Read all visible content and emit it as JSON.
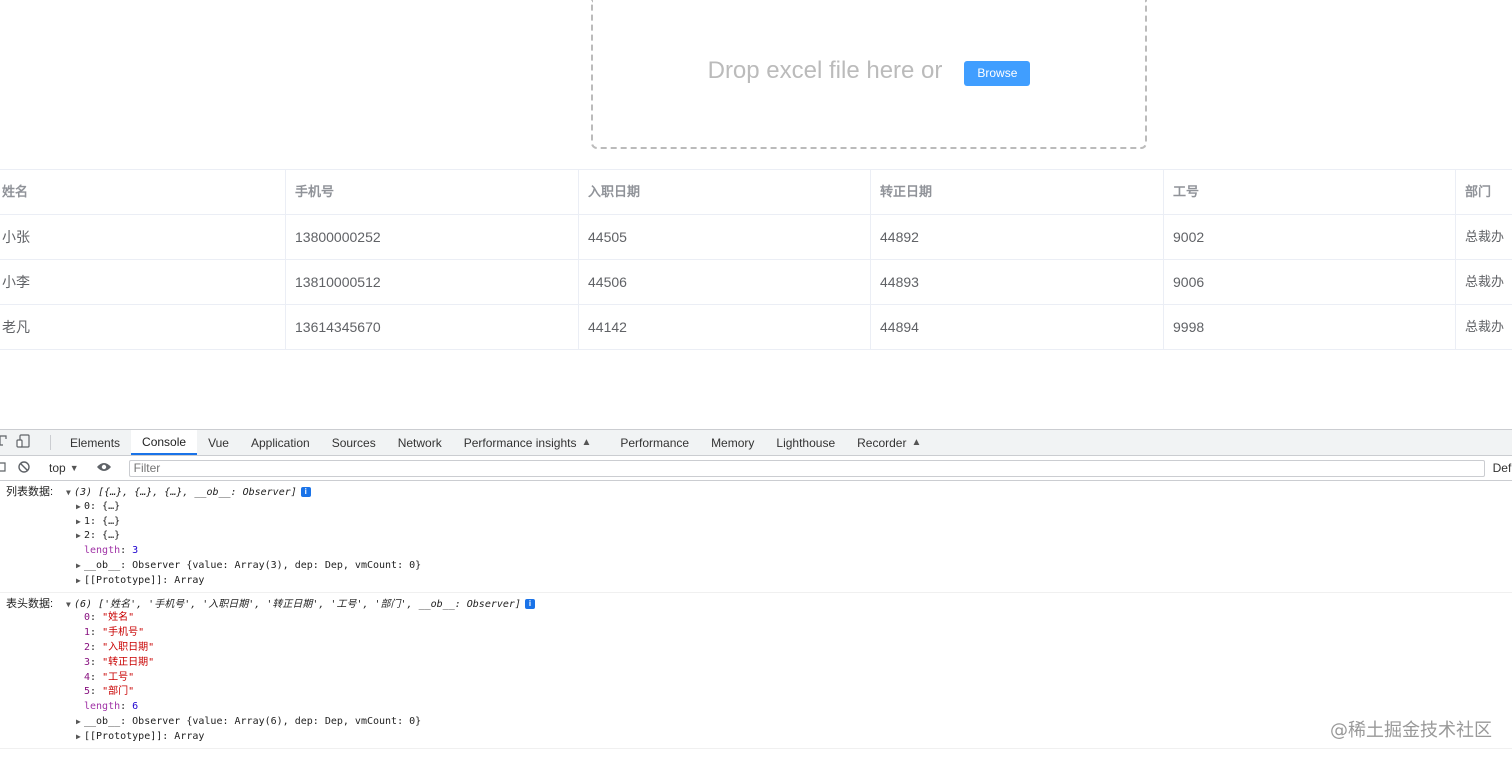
{
  "upload": {
    "drop_text": "Drop excel file here or",
    "browse_label": "Browse"
  },
  "table": {
    "headers": [
      "姓名",
      "手机号",
      "入职日期",
      "转正日期",
      "工号",
      "部门"
    ],
    "rows": [
      [
        "小张",
        "13800000252",
        "44505",
        "44892",
        "9002",
        "总裁办"
      ],
      [
        "小李",
        "13810000512",
        "44506",
        "44893",
        "9006",
        "总裁办"
      ],
      [
        "老凡",
        "13614345670",
        "44142",
        "44894",
        "9998",
        "总裁办"
      ]
    ]
  },
  "devtools": {
    "tabs": [
      "Elements",
      "Console",
      "Vue",
      "Application",
      "Sources",
      "Network",
      "Performance insights",
      "Performance",
      "Memory",
      "Lighthouse",
      "Recorder"
    ],
    "active_tab": "Console",
    "context": "top",
    "filter_placeholder": "Filter",
    "levels_label": "Def",
    "icons": {
      "inspect": "inspect-icon",
      "device": "device-toolbar-icon",
      "sidebar": "sidebar-icon",
      "clear": "clear-console-icon",
      "eye": "live-expression-icon",
      "flask": "experiment-icon",
      "info": "info-icon"
    }
  },
  "console": {
    "log1": {
      "label": "列表数据:",
      "summary": "(3) [{…}, {…}, {…}, __ob__: Observer]",
      "items": [
        "0: {…}",
        "1: {…}",
        "2: {…}"
      ],
      "length_key": "length",
      "length_value": "3",
      "ob_line": "__ob__: Observer {value: Array(3), dep: Dep, vmCount: 0}",
      "proto_line": "[[Prototype]]: Array"
    },
    "log2": {
      "label": "表头数据:",
      "summary": "(6) ['姓名', '手机号', '入职日期', '转正日期', '工号', '部门', __ob__: Observer]",
      "items": [
        {
          "key": "0",
          "value": "\"姓名\""
        },
        {
          "key": "1",
          "value": "\"手机号\""
        },
        {
          "key": "2",
          "value": "\"入职日期\""
        },
        {
          "key": "3",
          "value": "\"转正日期\""
        },
        {
          "key": "4",
          "value": "\"工号\""
        },
        {
          "key": "5",
          "value": "\"部门\""
        }
      ],
      "length_key": "length",
      "length_value": "6",
      "ob_line": "__ob__: Observer {value: Array(6), dep: Dep, vmCount: 0}",
      "proto_line": "[[Prototype]]: Array"
    }
  },
  "watermark": "@稀土掘金技术社区"
}
